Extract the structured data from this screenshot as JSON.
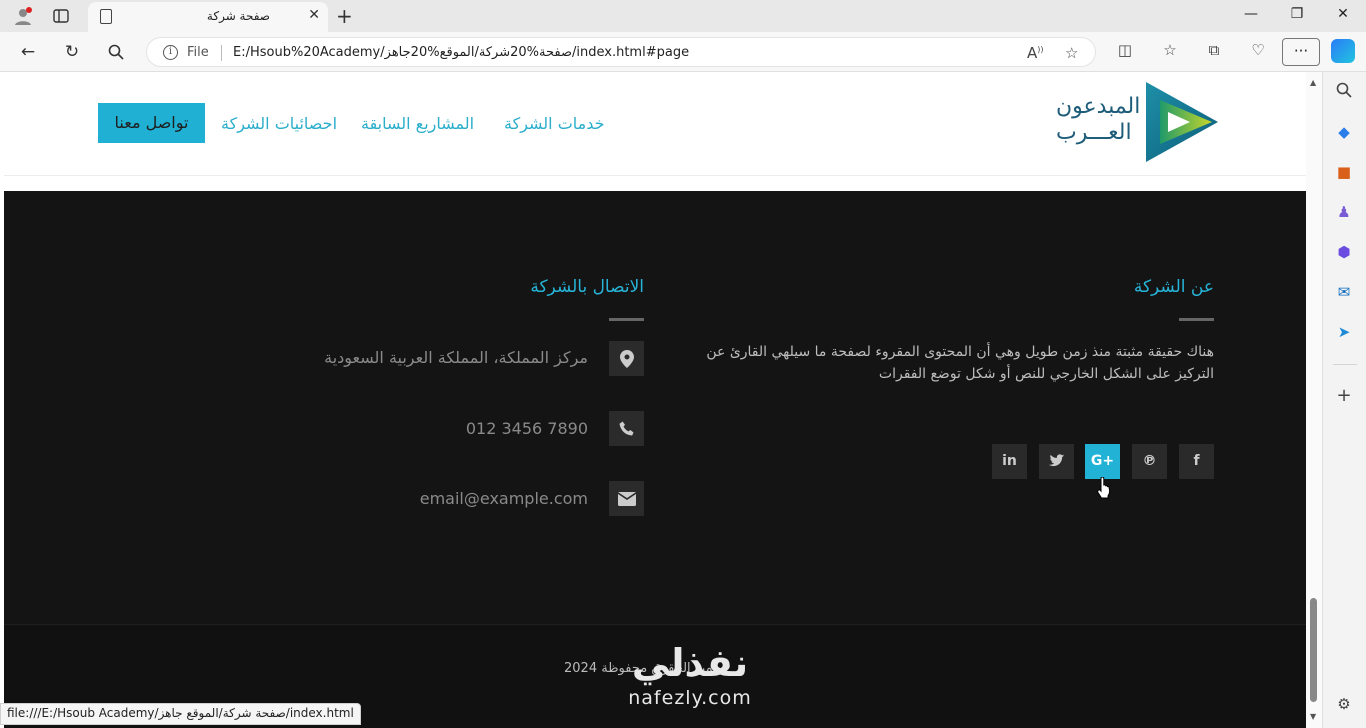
{
  "browser": {
    "tab_title": "صفحة شركة",
    "file_label": "File",
    "url": "E:/Hsoub%20Academy/صفحة%20شركة/الموقع%20جاهز/index.html#page",
    "status_url": "file:///E:/Hsoub Academy/صفحة شركة/الموقع جاهز/index.html",
    "icons": [
      "profile-icon",
      "tab-actions-icon",
      "page-icon",
      "close-icon",
      "plus-icon",
      "minimize-icon",
      "maximize-icon",
      "back-icon",
      "refresh-icon",
      "search-icon",
      "info-icon",
      "read-aloud-icon",
      "star-icon",
      "split-screen-icon",
      "favorites-icon",
      "collections-icon",
      "browser-essentials-icon",
      "more-icon",
      "copilot-icon"
    ]
  },
  "sidebar": {
    "icons": [
      "search-icon",
      "shopping-icon",
      "tools-icon",
      "games-icon",
      "microsoft365-icon",
      "outlook-icon",
      "telegram-icon",
      "add-icon",
      "settings-icon"
    ]
  },
  "header": {
    "logo_line1": "المبدعون",
    "logo_line2": "العـــرب",
    "nav": [
      "خدمات الشركة",
      "المشاريع السابقة",
      "احصائيات الشركة"
    ],
    "cta": "تواصل معنا"
  },
  "footer": {
    "about_title": "عن الشركة",
    "about_text": "هناك حقيقة مثبتة منذ زمن طويل وهي أن المحتوى المقروء لصفحة ما سيلهي القارئ عن التركيز على الشكل الخارجي للنص أو شكل توضع الفقرات",
    "social": [
      {
        "name": "facebook-icon",
        "glyph": "f"
      },
      {
        "name": "pinterest-icon",
        "glyph": "℗"
      },
      {
        "name": "google-plus-icon",
        "glyph": "G+"
      },
      {
        "name": "twitter-icon",
        "glyph": "🐦"
      },
      {
        "name": "linkedin-icon",
        "glyph": "in"
      }
    ],
    "contact_title": "الاتصال بالشركة",
    "contact": [
      {
        "icon": "location-icon",
        "text": "مركز المملكة، المملكة العربية السعودية"
      },
      {
        "icon": "phone-icon",
        "text": "7890 3456 012"
      },
      {
        "icon": "email-icon",
        "text": "email@example.com"
      }
    ],
    "copyright": "جميع الحقوق محفوظة 2024"
  },
  "watermark": {
    "arabic": "نفذلي",
    "latin": "nafezly.com"
  },
  "colors": {
    "accent": "#21b2d6",
    "footer_bg": "#141414",
    "logo_blue": "#1e5d7a"
  }
}
